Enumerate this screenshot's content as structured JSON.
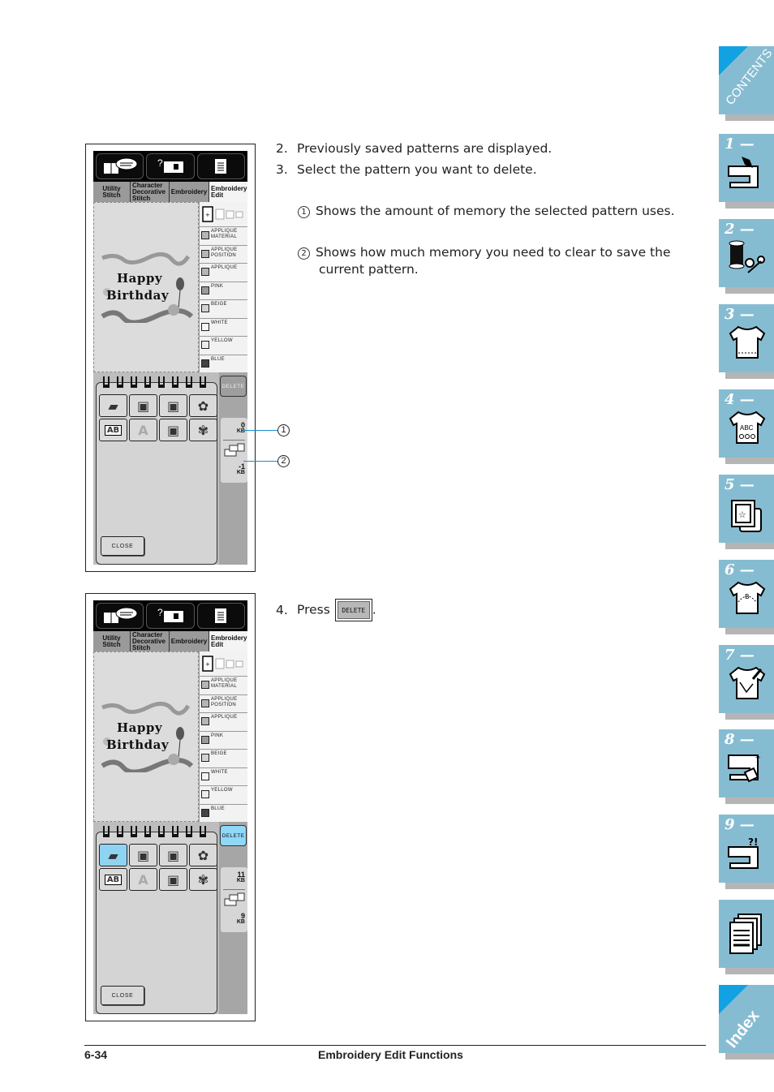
{
  "screen": {
    "tabs": [
      {
        "line1": "Utility",
        "line2": "Stitch",
        "line3": ""
      },
      {
        "line1": "Character",
        "line2": "Decorative",
        "line3": "Stitch"
      },
      {
        "line1": "Embroidery",
        "line2": "",
        "line3": ""
      },
      {
        "line1": "Embroidery",
        "line2": "Edit",
        "line3": ""
      }
    ],
    "preview_text": [
      "Happy",
      "Birthday"
    ],
    "colors": [
      {
        "name1": "APPLIQUE",
        "name2": "MATERIAL",
        "hex": "#b5b5b5"
      },
      {
        "name1": "APPLIQUE",
        "name2": "POSITION",
        "hex": "#b5b5b5"
      },
      {
        "name1": "APPLIQUE",
        "name2": "",
        "hex": "#b5b5b5"
      },
      {
        "name1": "PINK",
        "name2": "",
        "hex": "#9a9a9a"
      },
      {
        "name1": "BEIGE",
        "name2": "",
        "hex": "#d2d2d2"
      },
      {
        "name1": "WHITE",
        "name2": "",
        "hex": "#f5f5f5"
      },
      {
        "name1": "YELLOW",
        "name2": "",
        "hex": "#ececec"
      },
      {
        "name1": "BLUE",
        "name2": "",
        "hex": "#444444"
      }
    ],
    "close_label": "CLOSE",
    "delete_label": "DELETE",
    "kb_unit": "KB"
  },
  "figure1": {
    "selected_pattern": null,
    "delete_active": false,
    "memory_used": "0",
    "memory_to_clear": "-1"
  },
  "figure2": {
    "selected_pattern": 0,
    "delete_active": true,
    "memory_used": "11",
    "memory_to_clear": "9"
  },
  "callouts": [
    "1",
    "2"
  ],
  "instructions": {
    "step2": {
      "num": "2.",
      "text": "Previously saved patterns are displayed."
    },
    "step3": {
      "num": "3.",
      "text": "Select the pattern you want to delete."
    },
    "note1": {
      "num": "1",
      "text": "Shows the amount of memory the selected pattern uses."
    },
    "note2": {
      "num": "2",
      "text": "Shows how much memory you need to clear to save the current pattern."
    },
    "step4": {
      "num": "4.",
      "text": "Press",
      "button": "DELETE",
      "after": "."
    }
  },
  "footer": {
    "page": "6-34",
    "title": "Embroidery Edit Functions"
  },
  "side_tabs": [
    {
      "label": "CONTENTS",
      "icon": "contents-icon"
    },
    {
      "label": "1 —",
      "icon": "sewing-machine-hand-icon"
    },
    {
      "label": "2 —",
      "icon": "thread-scissors-icon"
    },
    {
      "label": "3 —",
      "icon": "shirt-stitch-icon"
    },
    {
      "label": "4 —",
      "icon": "shirt-abc-icon"
    },
    {
      "label": "5 —",
      "icon": "embroidery-frame-star-icon"
    },
    {
      "label": "6 —",
      "icon": "shirt-edit-icon"
    },
    {
      "label": "7 —",
      "icon": "shirt-pencil-icon"
    },
    {
      "label": "8 —",
      "icon": "machine-maintenance-icon"
    },
    {
      "label": "9 —",
      "icon": "machine-troubleshoot-icon"
    },
    {
      "label": "",
      "icon": "documents-icon"
    },
    {
      "label": "Index",
      "icon": "index-icon"
    }
  ]
}
